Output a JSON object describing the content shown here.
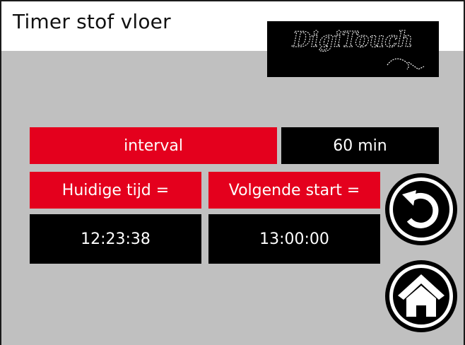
{
  "screen": {
    "title": "Timer stof vloer",
    "logo_text": "DigiTouch"
  },
  "interval_row": {
    "label": "interval",
    "value": "60 min"
  },
  "time_row": {
    "current_label": "Huidige tijd =",
    "next_label": "Volgende start =",
    "current_value": "12:23:38",
    "next_value": "13:00:00"
  },
  "buttons": {
    "back_icon": "refresh-back-icon",
    "home_icon": "home-icon"
  },
  "colors": {
    "accent_red": "#e4001d",
    "panel_black": "#000000",
    "background_gray": "#c0c0c0"
  }
}
